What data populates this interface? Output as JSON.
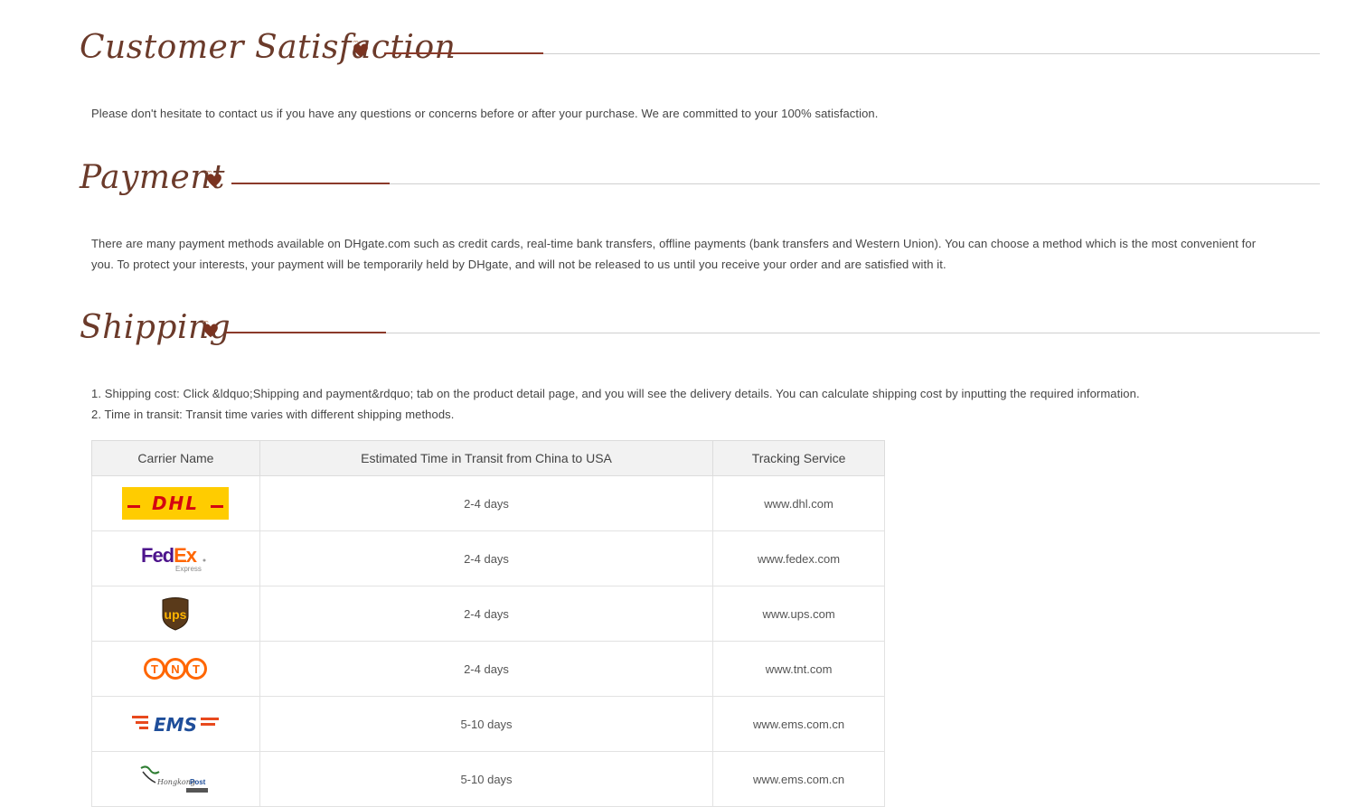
{
  "sections": {
    "satisfaction": {
      "title": "Customer Satisfaction",
      "text": "Please don't hesitate to contact us if you have any questions or concerns before or after your purchase. We are committed to your 100% satisfaction."
    },
    "payment": {
      "title": "Payment",
      "text": "There are many payment methods available on DHgate.com such as credit cards, real-time bank transfers, offline payments (bank transfers and Western Union). You can choose a method which is the most convenient for you. To protect your interests, your payment will be temporarily held by DHgate, and will not be released to us until you receive your order and are satisfied with it."
    },
    "shipping": {
      "title": "Shipping",
      "line1": "1. Shipping cost: Click &ldquo;Shipping and payment&rdquo; tab on the product detail page, and you will see the delivery details. You can calculate shipping cost by inputting the required information.",
      "line2": "2. Time in transit: Transit time varies with different shipping methods."
    }
  },
  "table": {
    "headers": [
      "Carrier Name",
      "Estimated Time in Transit from China to USA",
      "Tracking Service"
    ],
    "rows": [
      {
        "carrier": "DHL",
        "logo": "dhl-logo",
        "time": "2-4 days",
        "tracking": "www.dhl.com"
      },
      {
        "carrier": "FedEx Express",
        "logo": "fedex-logo",
        "time": "2-4 days",
        "tracking": "www.fedex.com"
      },
      {
        "carrier": "UPS",
        "logo": "ups-logo",
        "time": "2-4 days",
        "tracking": "www.ups.com"
      },
      {
        "carrier": "TNT",
        "logo": "tnt-logo",
        "time": "2-4 days",
        "tracking": "www.tnt.com"
      },
      {
        "carrier": "EMS",
        "logo": "ems-logo",
        "time": "5-10 days",
        "tracking": "www.ems.com.cn"
      },
      {
        "carrier": "HongkongPost",
        "logo": "hongkong-post-logo",
        "time": "5-10 days",
        "tracking": "www.ems.com.cn"
      }
    ]
  },
  "colors": {
    "title": "#6b3a2a",
    "accent_rule": "#8b3a2a",
    "heart": "#7a3320",
    "header_bg": "#f2f2f2"
  }
}
